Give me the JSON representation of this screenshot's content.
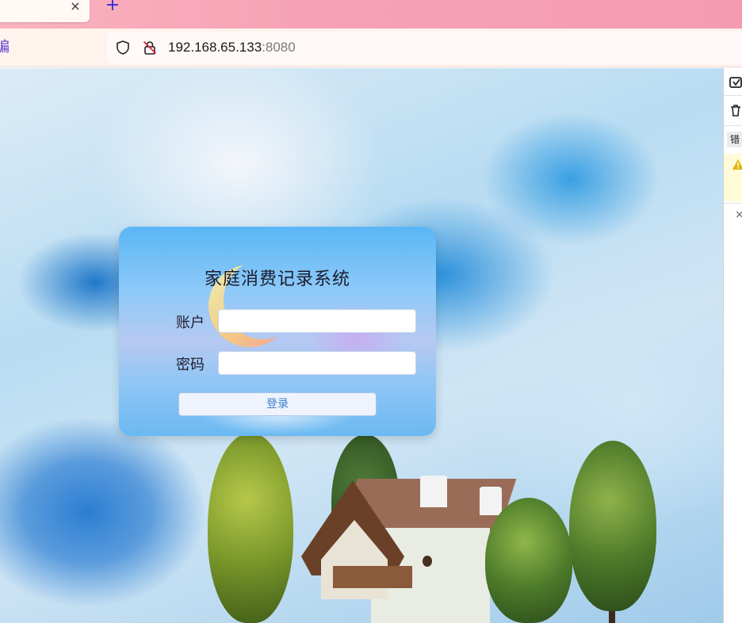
{
  "browser": {
    "tab": {
      "close_glyph": "×"
    },
    "new_tab_glyph": "+",
    "nav_edge_glyph": "编",
    "url": {
      "host": "192.168.65.133",
      "port": ":8080"
    },
    "icons": [
      "shield-icon",
      "lock-slash-icon",
      "close-icon",
      "plus-icon"
    ]
  },
  "devtools": {
    "label": "错",
    "close_glyph": "×",
    "icons": [
      "screenshot-icon",
      "trash-icon",
      "warning-icon",
      "close-icon"
    ]
  },
  "login": {
    "title": "家庭消费记录系统",
    "account_label": "账户",
    "password_label": "密码",
    "account_value": "",
    "password_value": "",
    "submit_label": "登录"
  },
  "colors": {
    "tab_strip": "#f7a2b6",
    "login_button_text": "#3a7fd0",
    "new_tab_plus": "#3a2bd6"
  }
}
